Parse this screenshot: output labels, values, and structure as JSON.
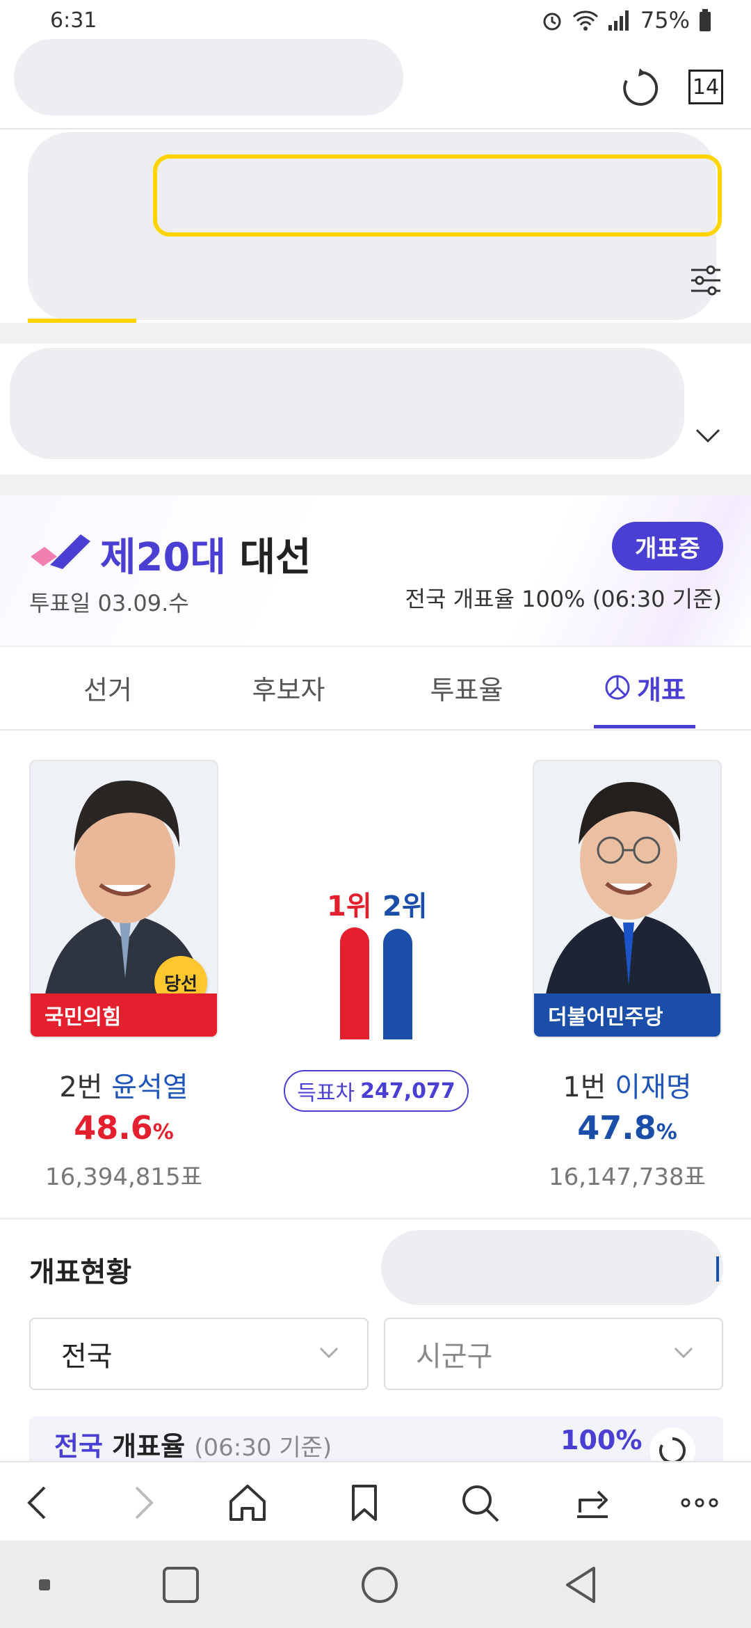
{
  "status_bar": {
    "time": "6:31",
    "battery": "75%"
  },
  "header": {
    "tab_count": "14"
  },
  "election": {
    "title_number": "제20대",
    "title_text": "대선",
    "vote_date": "투표일 03.09.수",
    "badge": "개표중",
    "count_rate": "전국 개표율 100% (06:30 기준)"
  },
  "tabs": [
    {
      "label": "선거"
    },
    {
      "label": "후보자"
    },
    {
      "label": "투표율"
    },
    {
      "label": "개표"
    }
  ],
  "candidates": {
    "left": {
      "party": "국민의힘",
      "number": "2번",
      "name": "윤석열",
      "percent": "48.6",
      "unit": "%",
      "votes": "16,394,815표",
      "win_badge": "당선",
      "color": "#e5202e"
    },
    "right": {
      "party": "더불어민주당",
      "number": "1번",
      "name": "이재명",
      "percent": "47.8",
      "unit": "%",
      "votes": "16,147,738표",
      "color": "#1a4ea8"
    }
  },
  "ranking": {
    "first": "1위",
    "second": "2위",
    "first_percent": 48.6,
    "second_percent": 47.8
  },
  "vote_diff": {
    "label": "득표차",
    "value": "247,077"
  },
  "status_section": {
    "title": "개표현황",
    "select_region": "전국",
    "select_district": "시군구",
    "rate_label_hl": "전국",
    "rate_label": "개표율",
    "rate_label_sub": "(06:30 기준)",
    "rate_value": "100%"
  },
  "colors": {
    "accent": "#4a3fd3",
    "search_border": "#ffd400",
    "ppp_red": "#e5202e",
    "dem_blue": "#1a4ea8"
  },
  "icons": {
    "browser_nav": [
      "back-icon",
      "forward-icon",
      "home-icon",
      "bookmark-icon",
      "search-icon",
      "share-icon",
      "more-icon"
    ],
    "system_nav": [
      "recents-icon",
      "home-circle-icon",
      "back-triangle-icon"
    ]
  }
}
